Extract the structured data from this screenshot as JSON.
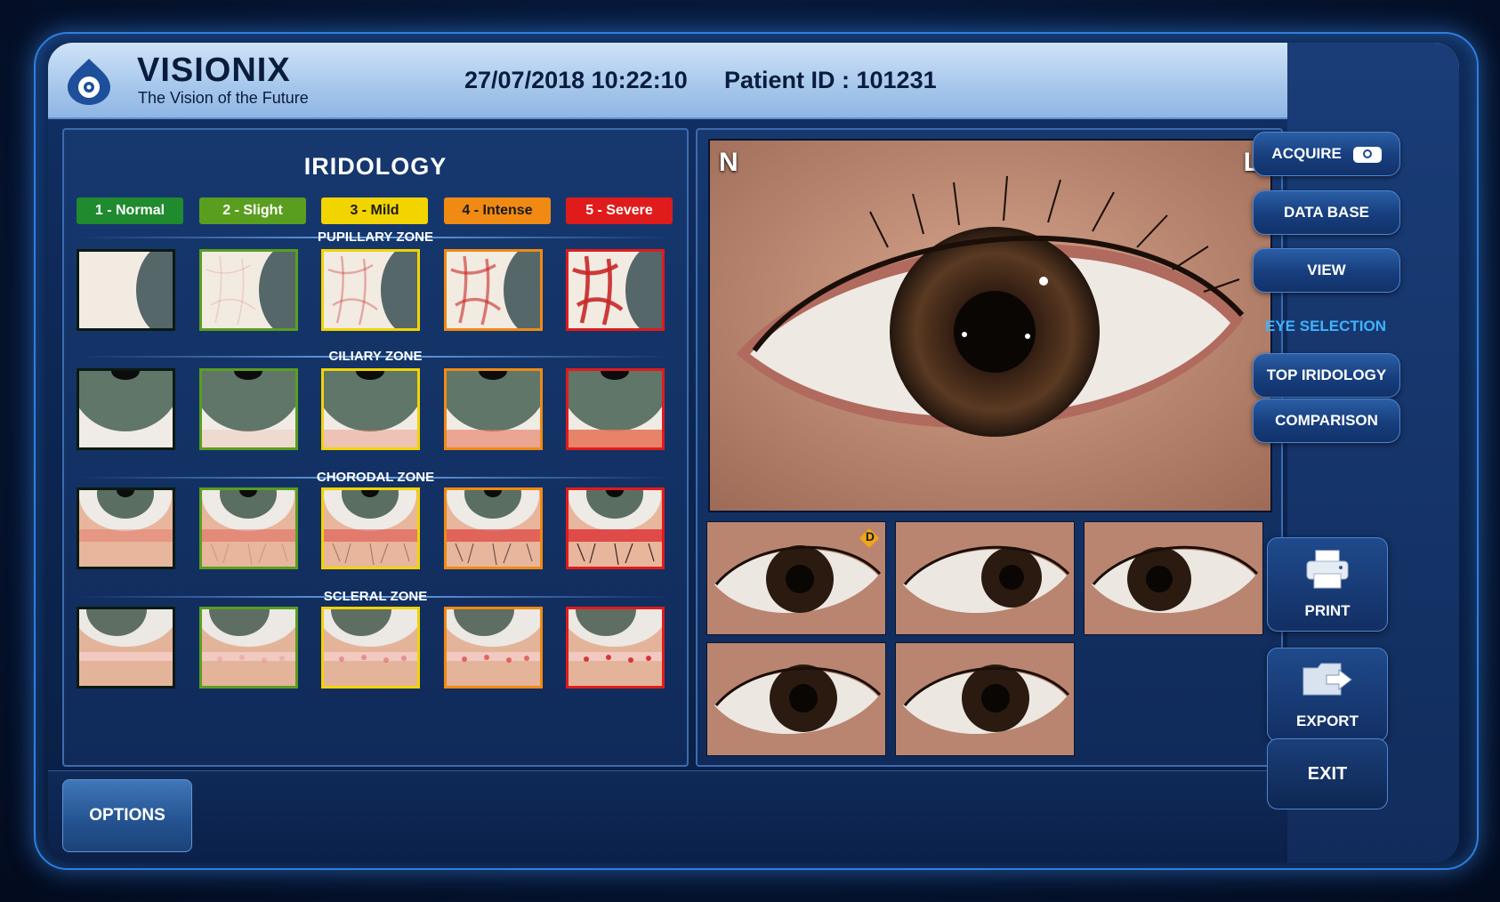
{
  "header": {
    "brand": "VISIONIX",
    "tagline": "The Vision of the Future",
    "datetime": "27/07/2018 10:22:10",
    "patient": "Patient ID : 101231"
  },
  "iridology": {
    "title": "IRIDOLOGY",
    "severity": [
      {
        "label": "1 - Normal",
        "color": "#1f8a2e",
        "text": "#ffffff"
      },
      {
        "label": "2 - Slight",
        "color": "#5a9e1f",
        "text": "#ffffff"
      },
      {
        "label": "3 - Mild",
        "color": "#f2d400",
        "text": "#1a1a1a"
      },
      {
        "label": "4 - Intense",
        "color": "#f08a12",
        "text": "#1a1a1a"
      },
      {
        "label": "5 - Severe",
        "color": "#e01b1b",
        "text": "#ffffff"
      }
    ],
    "zones": [
      "PUPILLARY ZONE",
      "CILIARY ZONE",
      "CHORODAL ZONE",
      "SCLERAL ZONE"
    ],
    "border_colors": [
      "#0b1a10",
      "#5a9e1f",
      "#f2d400",
      "#f08a12",
      "#e01b1b"
    ]
  },
  "viewer": {
    "corner_left": "N",
    "corner_right": "L",
    "badge": "D",
    "thumbnail_count": 5
  },
  "sidebar": {
    "acquire": "ACQUIRE",
    "database": "DATA BASE",
    "view": "VIEW",
    "eye_selection": "EYE SELECTION",
    "top_iridology": "TOP IRIDOLOGY",
    "comparison": "COMPARISON",
    "print": "PRINT",
    "export": "EXPORT",
    "exit": "EXIT"
  },
  "footer": {
    "options": "OPTIONS"
  },
  "colors": {
    "accent": "#3fb3ff",
    "frame_glow": "#2f7fe0"
  }
}
